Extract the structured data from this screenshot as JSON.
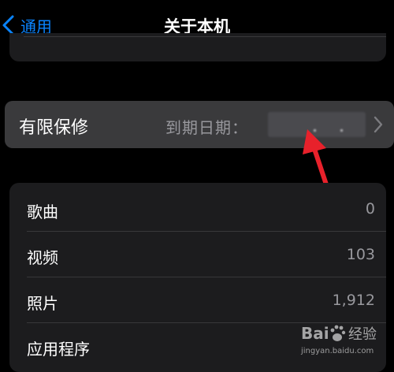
{
  "nav": {
    "back_label": "通用",
    "title": "关于本机"
  },
  "warranty": {
    "label": "有限保修",
    "value_prefix": "到期日期："
  },
  "stats": [
    {
      "label": "歌曲",
      "value": "0"
    },
    {
      "label": "视频",
      "value": "103"
    },
    {
      "label": "照片",
      "value": "1,912"
    },
    {
      "label": "应用程序",
      "value": ""
    }
  ],
  "watermark": {
    "brand_text": "Bai 经验",
    "url": "jingyan.baidu.com"
  },
  "colors": {
    "accent": "#0a84ff",
    "annotation_arrow": "#e8212b",
    "cell_background": "#1c1c1e",
    "highlight_background": "#3a3a3c"
  },
  "icons": {
    "back": "chevron-left-icon",
    "disclosure": "chevron-right-icon",
    "annotation": "red-arrow-icon",
    "watermark": "baidu-paw-icon"
  }
}
